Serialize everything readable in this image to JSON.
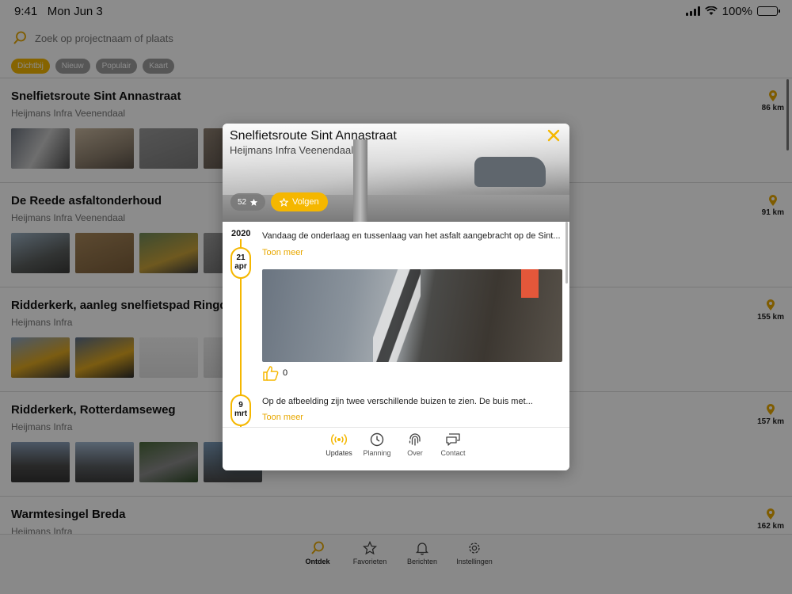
{
  "status": {
    "time": "9:41",
    "date": "Mon Jun 3",
    "battery": "100%"
  },
  "search": {
    "placeholder": "Zoek op projectnaam of plaats"
  },
  "filters": [
    {
      "label": "Dichtbij",
      "active": true
    },
    {
      "label": "Nieuw",
      "active": false
    },
    {
      "label": "Populair",
      "active": false
    },
    {
      "label": "Kaart",
      "active": false
    }
  ],
  "projects": [
    {
      "name": "Snelfietsroute Sint Annastraat",
      "company": "Heijmans Infra Veenendaal",
      "distance": "86 km"
    },
    {
      "name": "De Reede asfaltonderhoud",
      "company": "Heijmans Infra Veenendaal",
      "distance": "91 km"
    },
    {
      "name": "Ridderkerk, aanleg snelfietspad Ringdijk",
      "company": "Heijmans Infra",
      "distance": "155 km"
    },
    {
      "name": "Ridderkerk, Rotterdamseweg",
      "company": "Heijmans Infra",
      "distance": "157 km"
    },
    {
      "name": "Warmtesingel Breda",
      "company": "Heijmans Infra",
      "distance": "162 km"
    }
  ],
  "tabbar": [
    {
      "label": "Ontdek",
      "icon": "search-icon",
      "active": true
    },
    {
      "label": "Favorieten",
      "icon": "star-icon",
      "active": false
    },
    {
      "label": "Berichten",
      "icon": "bell-icon",
      "active": false
    },
    {
      "label": "Instellingen",
      "icon": "gear-icon",
      "active": false
    }
  ],
  "modal": {
    "title": "Snelfietsroute Sint Annastraat",
    "subtitle": "Heijmans Infra Veenendaal",
    "follower_count": "52",
    "follow_label": "Volgen",
    "year": "2020",
    "updates": [
      {
        "day": "21",
        "month": "apr",
        "text": "Vandaag de onderlaag en tussenlaag van het asfalt aangebracht op de Sint...",
        "more": "Toon meer",
        "likes": "0"
      },
      {
        "day": "9",
        "month": "mrt",
        "text": "Op de afbeelding zijn twee verschillende buizen te zien. De buis met...",
        "more": "Toon meer"
      }
    ],
    "tabs": [
      {
        "label": "Updates",
        "icon": "broadcast-icon",
        "active": true
      },
      {
        "label": "Planning",
        "icon": "clock-icon",
        "active": false
      },
      {
        "label": "Over",
        "icon": "fingerprint-icon",
        "active": false
      },
      {
        "label": "Contact",
        "icon": "chat-icon",
        "active": false
      }
    ]
  },
  "colors": {
    "accent": "#f5b700",
    "link": "#e8a800"
  }
}
